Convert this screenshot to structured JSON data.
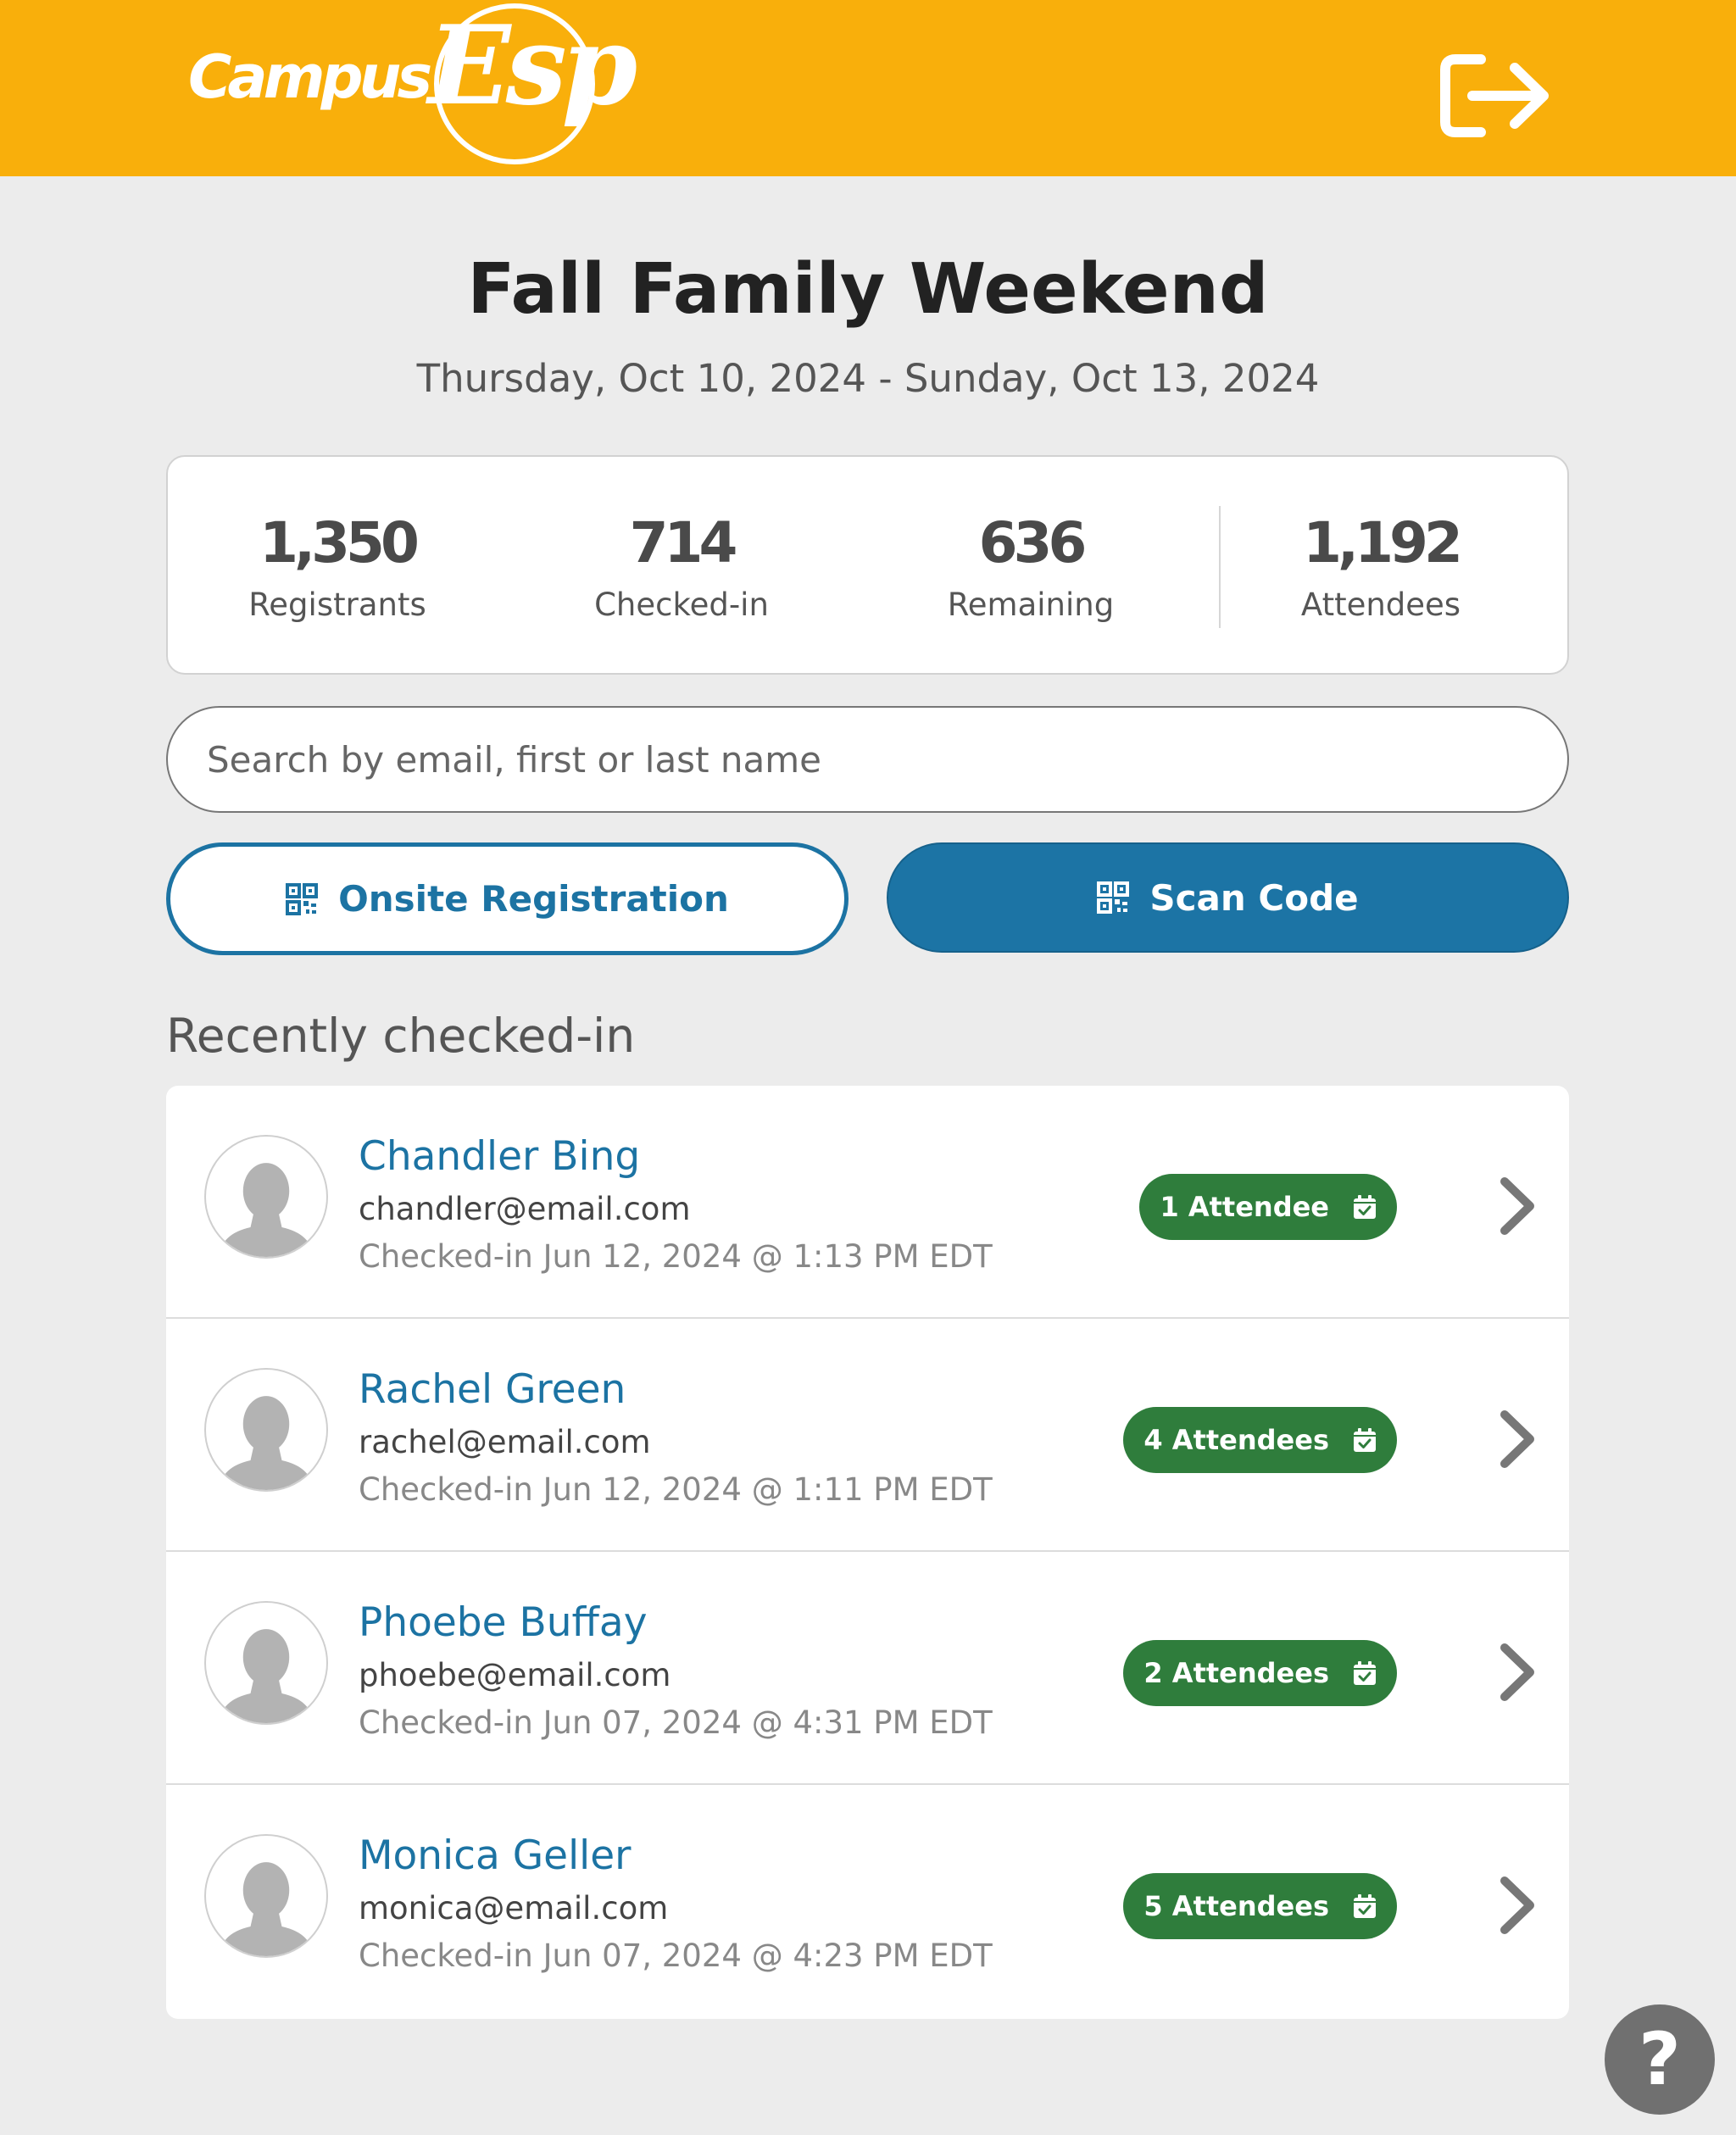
{
  "header": {
    "logo_text_campus": "Campus",
    "logo_text_esp": "Esp",
    "logout_icon": "logout-arrow-icon",
    "background_color": "#f9af0b"
  },
  "event": {
    "title": "Fall Family Weekend",
    "dates": "Thursday, Oct 10, 2024 - Sunday, Oct 13, 2024"
  },
  "stats": [
    {
      "value": "1,350",
      "label": "Registrants"
    },
    {
      "value": "714",
      "label": "Checked-in"
    },
    {
      "value": "636",
      "label": "Remaining"
    },
    {
      "value": "1,192",
      "label": "Attendees"
    }
  ],
  "search": {
    "placeholder": "Search by email, first or last name",
    "value": ""
  },
  "buttons": {
    "onsite_label": "Onsite Registration",
    "scan_label": "Scan Code",
    "icon": "qr-code-icon",
    "accent_color": "#1c74a5"
  },
  "recent": {
    "title": "Recently checked-in",
    "items": [
      {
        "name": "Chandler Bing",
        "email": "chandler@email.com",
        "checked_in": "Checked-in Jun 12, 2024 @ 1:13 PM EDT",
        "badge": "1 Attendee"
      },
      {
        "name": "Rachel Green",
        "email": "rachel@email.com",
        "checked_in": "Checked-in Jun 12, 2024 @ 1:11 PM EDT",
        "badge": "4 Attendees"
      },
      {
        "name": "Phoebe Buffay",
        "email": "phoebe@email.com",
        "checked_in": "Checked-in Jun 07, 2024 @ 4:31 PM EDT",
        "badge": "2 Attendees"
      },
      {
        "name": "Monica Geller",
        "email": "monica@email.com",
        "checked_in": "Checked-in Jun 07, 2024 @ 4:23 PM EDT",
        "badge": "5 Attendees"
      }
    ],
    "badge_color": "#2f7d3c"
  },
  "help": {
    "label": "?"
  }
}
